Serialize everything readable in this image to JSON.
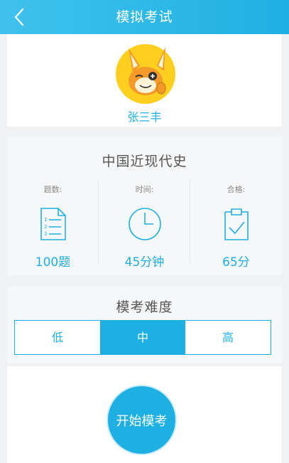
{
  "header": {
    "title": "模拟考试",
    "back_icon": "chevron-left-icon"
  },
  "user": {
    "name": "张三丰"
  },
  "exam": {
    "subject": "中国近现代史",
    "stats": [
      {
        "label": "题数:",
        "value": "100题",
        "icon": "document-list-icon"
      },
      {
        "label": "时间:",
        "value": "45分钟",
        "icon": "clock-icon"
      },
      {
        "label": "合格:",
        "value": "65分",
        "icon": "clipboard-check-icon"
      }
    ]
  },
  "difficulty": {
    "title": "模考难度",
    "options": [
      "低",
      "中",
      "高"
    ],
    "selected": "中"
  },
  "start_button": "开始模考",
  "colors": {
    "accent": "#1fb0e3",
    "header_start": "#3fc2ec",
    "avatar_bg": "#ffcf1f"
  }
}
